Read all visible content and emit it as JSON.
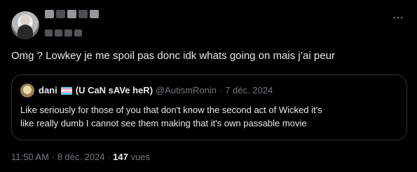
{
  "tweet": {
    "text": "Omg ? Lowkey je me spoil pas donc idk whats going on mais j’ai peur",
    "time": "11:50 AM",
    "separator": "·",
    "date": "8 déc. 2024",
    "views_count": "147",
    "views_label": "vues"
  },
  "quote": {
    "author_name": "dani",
    "author_name_suffix": "(U CaN sAVe heR)",
    "handle": "@AutismRonin",
    "separator": "·",
    "date": "7 déc. 2024",
    "flag_colors": [
      "#5BCEFA",
      "#F5A9B8",
      "#FFFFFF",
      "#F5A9B8",
      "#5BCEFA"
    ],
    "text_lines": [
      "Like seriously for those of you that don't know the second act of Wicked it's",
      "like really dumb I cannot see them making that it's own passable movie"
    ]
  },
  "icons": {
    "more": "more-horizontal-icon"
  },
  "colors": {
    "background": "#000000",
    "text_primary": "#e7e9ea",
    "text_secondary": "#71767b",
    "border": "#2f3336"
  }
}
